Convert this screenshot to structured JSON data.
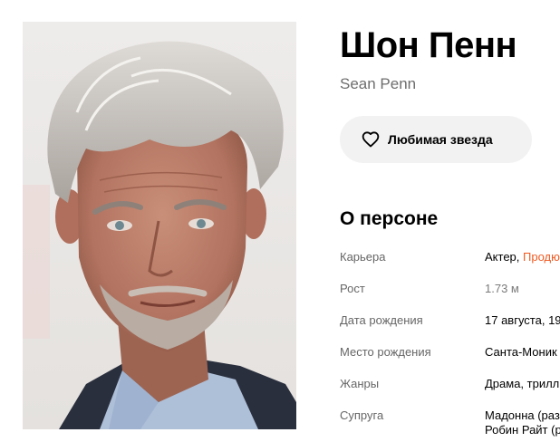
{
  "person": {
    "name": "Шон Пенн",
    "original_name": "Sean Penn"
  },
  "favorite_button": {
    "label": "Любимая звезда",
    "icon": "heart-outline-icon"
  },
  "about": {
    "title": "О персоне",
    "rows": [
      {
        "key": "Карьера",
        "value_part1": "Актер, ",
        "value_link": "Продю"
      },
      {
        "key": "Рост",
        "value": "1.73 м"
      },
      {
        "key": "Дата рождения",
        "value": "17 августа, 19"
      },
      {
        "key": "Место рождения",
        "value": "Санта-Моник"
      },
      {
        "key": "Жанры",
        "value": "Драма, трилл"
      },
      {
        "key": "Супруга",
        "value_line1": "Мадонна (раз",
        "value_line2": "Робин Райт (р"
      }
    ]
  },
  "colors": {
    "accent_link": "#f05a22",
    "button_bg": "#f2f2f2",
    "muted_text": "#666666"
  }
}
